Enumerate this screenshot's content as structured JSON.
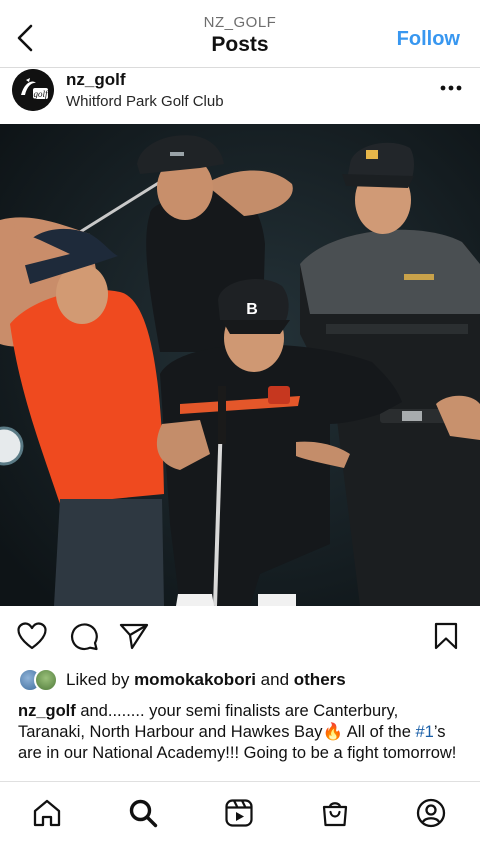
{
  "header": {
    "account": "NZ_GOLF",
    "title": "Posts",
    "follow_label": "Follow"
  },
  "post": {
    "username": "nz_golf",
    "location": "Whitford Park Golf Club",
    "avatar_text": "golf",
    "likes": {
      "prefix": "Liked by",
      "user": "momokakobori",
      "and": "and",
      "others": "others"
    },
    "caption": {
      "username": "nz_golf",
      "text_1": " and........ your semi finalists are Canterbury, Taranaki, North Harbour and Hawkes Bay",
      "emoji": "🔥",
      "text_2": " All of the ",
      "hashtag": "#1",
      "text_3": "’s are in our National Academy!!! Going to be a fight tomorrow!"
    }
  },
  "colors": {
    "accent": "#3897f0",
    "hashtag": "#1a5fa8",
    "photo_bg": "#121a1d"
  },
  "icons": {
    "back": "chevron-left-icon",
    "more": "more-dots-icon",
    "like": "heart-icon",
    "comment": "comment-icon",
    "share": "send-icon",
    "save": "bookmark-icon",
    "home": "home-icon",
    "search": "search-icon",
    "reels": "reels-icon",
    "shop": "shop-icon",
    "profile": "profile-icon"
  }
}
